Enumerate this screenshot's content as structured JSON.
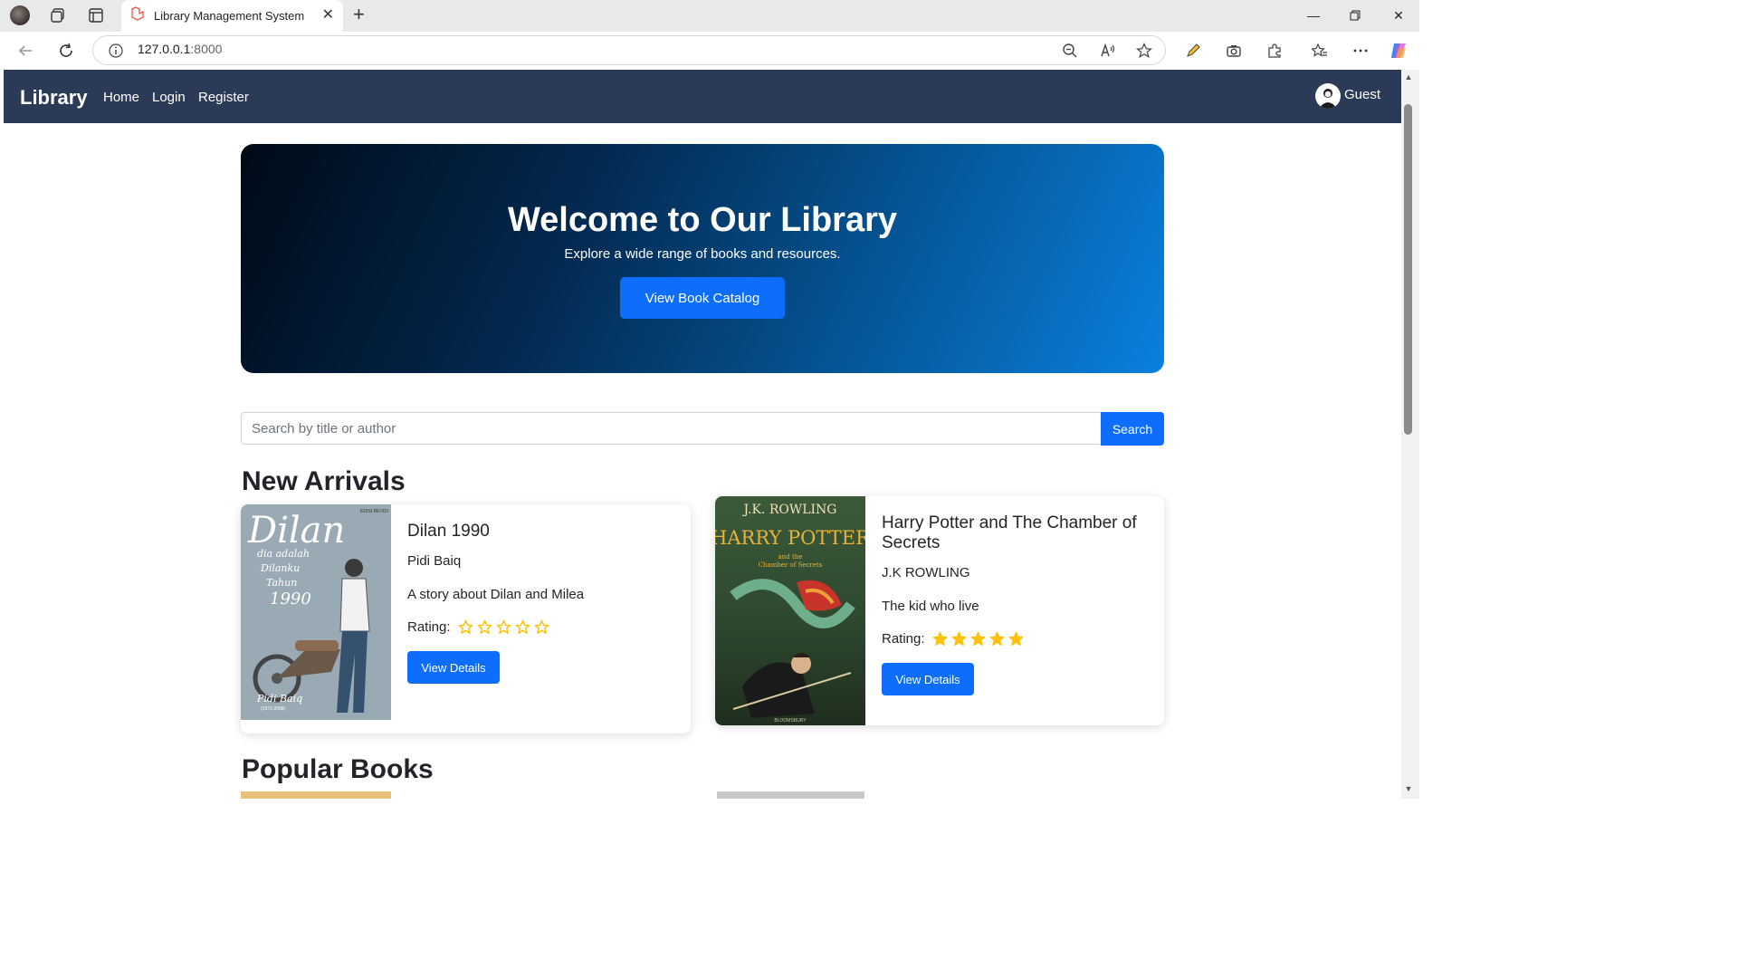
{
  "browser": {
    "tab_title": "Library Management System",
    "url_host": "127.0.0.1",
    "url_port": ":8000"
  },
  "navbar": {
    "brand": "Library",
    "links": [
      "Home",
      "Login",
      "Register"
    ],
    "user": "Guest"
  },
  "hero": {
    "title": "Welcome to Our Library",
    "subtitle": "Explore a wide range of books and resources.",
    "button": "View Book Catalog"
  },
  "search": {
    "placeholder": "Search by title or author",
    "value": "",
    "button": "Search"
  },
  "sections": {
    "new_arrivals": "New Arrivals",
    "popular": "Popular Books"
  },
  "books": [
    {
      "title": "Dilan 1990",
      "author": "Pidi Baiq",
      "description": "A story about Dilan and Milea",
      "rating_label": "Rating:",
      "rating": 0,
      "max_rating": 5,
      "button": "View Details",
      "cover_text": [
        "Dilan",
        "dia adalah",
        "Dilanku",
        "Tahun",
        "1990",
        "EDISI REVISI",
        "Pidi Baiq",
        "(1972-2098)"
      ]
    },
    {
      "title": "Harry Potter and The Chamber of Secrets",
      "author": "J.K ROWLING",
      "description": "The kid who live",
      "rating_label": "Rating:",
      "rating": 5,
      "max_rating": 5,
      "button": "View Details",
      "cover_text": [
        "J.K. ROWLING",
        "HARRY POTTER",
        "and the",
        "Chamber of Secrets",
        "BLOOMSBURY"
      ]
    }
  ],
  "colors": {
    "navbar": "#2a3a57",
    "primary": "#0d6efd",
    "star": "#ffc107"
  }
}
